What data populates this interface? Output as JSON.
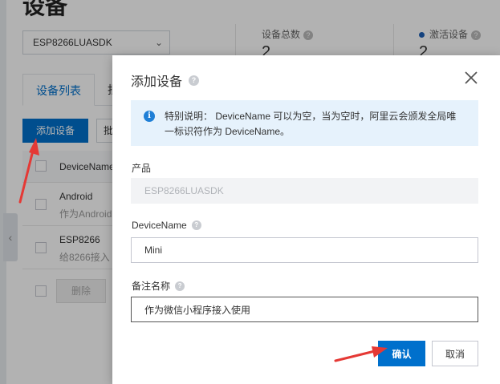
{
  "background": {
    "page_title": "设备",
    "product_select": "ESP8266LUASDK",
    "stats": [
      {
        "label": "设备总数",
        "value": "2"
      },
      {
        "label": "激活设备",
        "value": "2"
      }
    ],
    "tabs": [
      {
        "label": "设备列表"
      },
      {
        "label": "批"
      }
    ],
    "add_device_button": "添加设备",
    "second_button": "批",
    "table": {
      "header": "DeviceName",
      "rows": [
        {
          "name": "Android",
          "note": "作为Android"
        },
        {
          "name": "ESP8266",
          "note": "给8266接入"
        }
      ]
    },
    "delete_button": "删除"
  },
  "dialog": {
    "title": "添加设备",
    "notice": "特别说明： DeviceName 可以为空，当为空时，阿里云会颁发全局唯一标识符作为 DeviceName。",
    "product_label": "产品",
    "product_value": "ESP8266LUASDK",
    "devicename_label": "DeviceName",
    "devicename_value": "Mini",
    "remark_label": "备注名称",
    "remark_value": "作为微信小程序接入使用",
    "confirm_label": "确认",
    "cancel_label": "取消"
  },
  "colors": {
    "primary": "#0070cc",
    "notice_bg": "#e6f2fc",
    "annotation_arrow": "#e53935"
  },
  "icons": [
    "help-icon",
    "close-icon",
    "info-icon",
    "chevron-down-icon",
    "chevron-left-icon",
    "red-arrow"
  ]
}
